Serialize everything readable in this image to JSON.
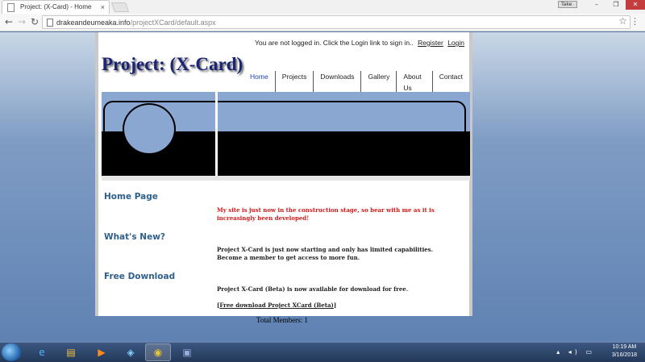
{
  "browser": {
    "tab_title": "Project: (X-Card) - Home",
    "tab_close": "×",
    "address_host": "drakeandeumeaka.info",
    "address_path": "/projectXCard/default.aspx",
    "star_icon": "star-icon",
    "menu_icon": "more-vert-icon"
  },
  "window_controls": {
    "ime_label": "Take",
    "minimize": "–",
    "maximize": "❐",
    "close": "✕"
  },
  "page": {
    "login_text": "You are not logged in. Click the Login link to sign in..",
    "register_label": "Register",
    "login_label": "Login",
    "site_title": "Project: (X-Card)",
    "nav": [
      "Home",
      "Projects",
      "Downloads",
      "Gallery",
      "About Us",
      "Contact"
    ],
    "sections": [
      {
        "heading": "Home Page",
        "text": "My site is just now in the construction stage, so bear with me as it is increasingly been developed!"
      },
      {
        "heading": "What's New?",
        "text": "Project X-Card is just now starting and only has limited capabilities. Become a member to get access to more fun."
      },
      {
        "heading": "Free Download",
        "text": "Project X-Card (Beta) is now available for download for free.",
        "link_open": "[",
        "link_label": "Free download Project XCard (Beta)",
        "link_close": "]"
      }
    ],
    "total_members": "Total Members: 1"
  },
  "taskbar": {
    "time": "10:19 AM",
    "date": "3/16/2018",
    "tray_icons": "▴ ◂) ▭"
  }
}
